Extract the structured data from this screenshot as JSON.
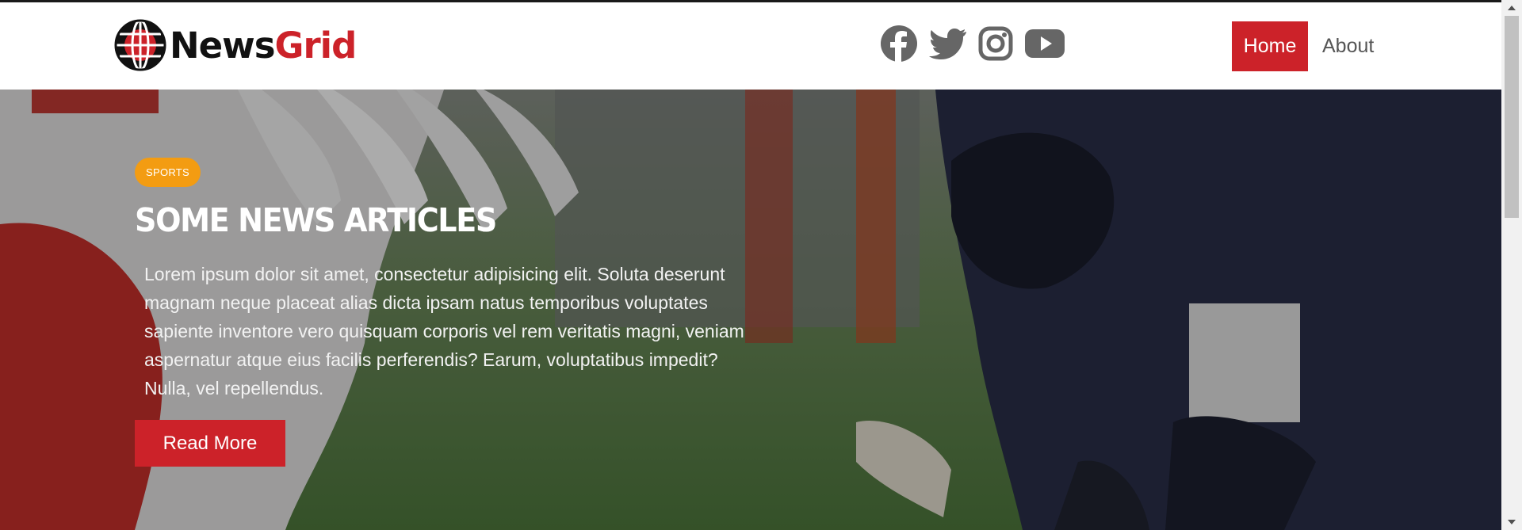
{
  "brand": {
    "name_part1": "News",
    "name_part2": "Grid"
  },
  "social_icons": [
    "facebook-icon",
    "twitter-icon",
    "instagram-icon",
    "youtube-icon"
  ],
  "nav": {
    "home": "Home",
    "about": "About"
  },
  "hero": {
    "badge": "SPORTS",
    "title": "SOME NEWS ARTICLES",
    "body": "Lorem ipsum dolor sit amet, consectetur adipisicing elit. Soluta deserunt magnam neque placeat alias dicta ipsam natus temporibus voluptates sapiente inventore vero quisquam corporis vel rem veritatis magni, veniam aspernatur atque eius facilis perferendis? Earum, voluptatibus impedit? Nulla, vel repellendus.",
    "button": "Read More"
  },
  "colors": {
    "accent": "#cc2229",
    "badge": "#f39c12",
    "icon": "#666666"
  }
}
